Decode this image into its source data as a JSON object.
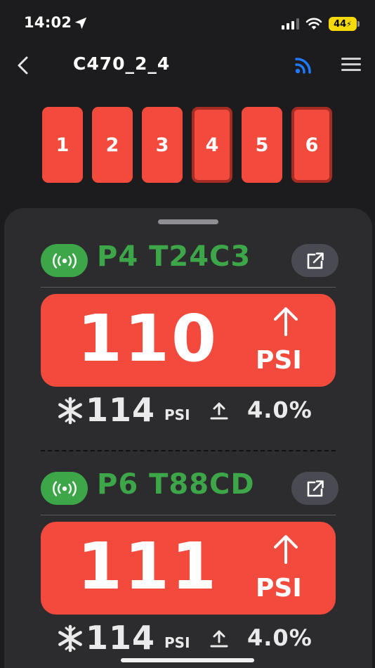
{
  "status_bar": {
    "time": "14:02",
    "battery": "44"
  },
  "nav": {
    "title": "C470_2_4"
  },
  "positions": [
    {
      "label": "1",
      "selected": false
    },
    {
      "label": "2",
      "selected": false
    },
    {
      "label": "3",
      "selected": false
    },
    {
      "label": "4",
      "selected": true
    },
    {
      "label": "5",
      "selected": false
    },
    {
      "label": "6",
      "selected": true
    }
  ],
  "sensors": [
    {
      "name": "P4 T24C3",
      "pressure": "110",
      "unit": "PSI",
      "cold_pressure": "114",
      "cold_unit": "PSI",
      "percent": "4.0%"
    },
    {
      "name": "P6 T88CD",
      "pressure": "111",
      "unit": "PSI",
      "cold_pressure": "114",
      "cold_unit": "PSI",
      "percent": "4.0%"
    }
  ],
  "colors": {
    "alert_red": "#f24a3d",
    "connected_green": "#3da649",
    "accent_blue": "#1f7bff",
    "background": "#1c1c1e",
    "sheet": "#2c2c2e"
  },
  "icons": {
    "back": "chevron-left-icon",
    "connection": "wifi-icon",
    "menu": "hamburger-menu-icon",
    "signal": "broadcast-signal-icon",
    "open": "external-link-icon",
    "trend": "arrow-up-icon",
    "cold": "snowflake-icon",
    "offset": "upload-arrow-icon"
  }
}
